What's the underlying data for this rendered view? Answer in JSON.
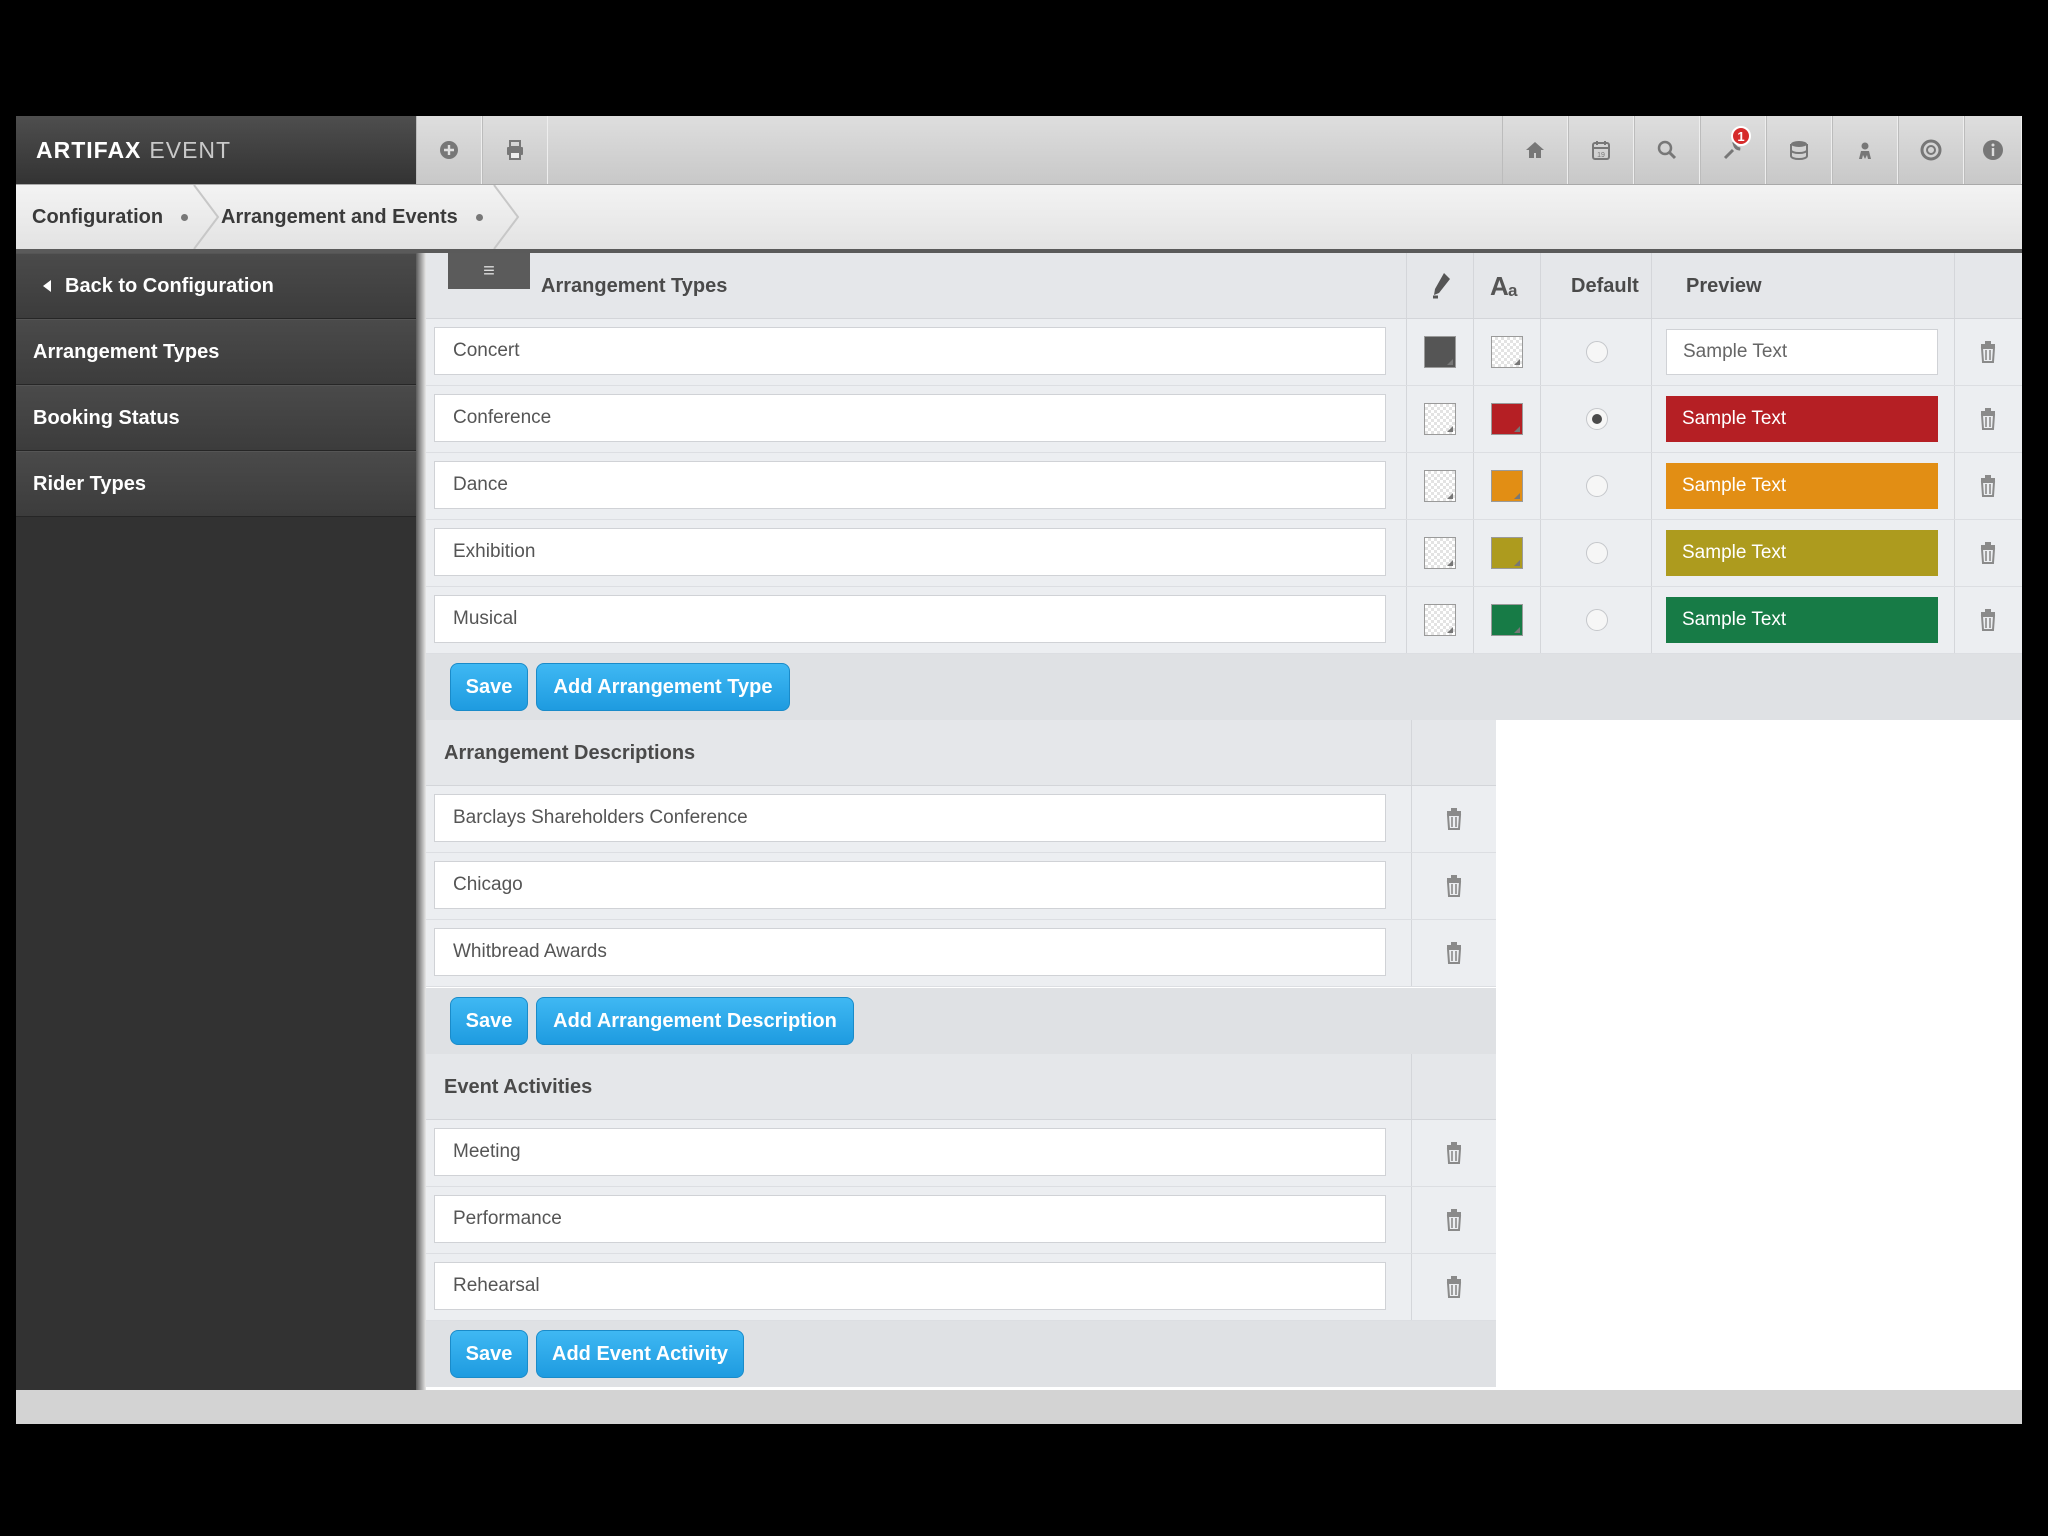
{
  "brand": {
    "name": "ARTIFAX",
    "suffix": "EVENT"
  },
  "topbar": {
    "left_icons": [
      "plus-circle-icon",
      "print-icon"
    ],
    "right_icons": [
      "home-icon",
      "calendar-icon",
      "search-icon",
      "wrench-icon",
      "database-icon",
      "user-icon",
      "help-ring-icon",
      "info-icon"
    ],
    "notification_count": "1"
  },
  "breadcrumb": [
    "Configuration",
    "Arrangement and Events"
  ],
  "sidebar": {
    "back_label": "Back to Configuration",
    "items": [
      "Arrangement Types",
      "Booking Status",
      "Rider Types"
    ]
  },
  "arrangement_types": {
    "title": "Arrangement Types",
    "col_default": "Default",
    "col_preview": "Preview",
    "rows": [
      {
        "name": "Concert",
        "bg": "#555555",
        "fg": "empty",
        "default": false,
        "preview": "Sample Text",
        "preview_bg": "#ffffff",
        "preview_fg": "#666666"
      },
      {
        "name": "Conference",
        "bg": "empty",
        "fg": "#b51f24",
        "default": true,
        "preview": "Sample Text",
        "preview_bg": "#b51f24",
        "preview_fg": "#ffffff"
      },
      {
        "name": "Dance",
        "bg": "empty",
        "fg": "#e28e14",
        "default": false,
        "preview": "Sample Text",
        "preview_bg": "#e28e14",
        "preview_fg": "#ffffff"
      },
      {
        "name": "Exhibition",
        "bg": "empty",
        "fg": "#ad9b1e",
        "default": false,
        "preview": "Sample Text",
        "preview_bg": "#ad9b1e",
        "preview_fg": "#ffffff"
      },
      {
        "name": "Musical",
        "bg": "empty",
        "fg": "#177b46",
        "default": false,
        "preview": "Sample Text",
        "preview_bg": "#177b46",
        "preview_fg": "#ffffff"
      }
    ],
    "save_label": "Save",
    "add_label": "Add Arrangement Type"
  },
  "arrangement_descriptions": {
    "title": "Arrangement Descriptions",
    "rows": [
      "Barclays Shareholders Conference",
      "Chicago",
      "Whitbread Awards"
    ],
    "save_label": "Save",
    "add_label": "Add Arrangement Description"
  },
  "event_activities": {
    "title": "Event Activities",
    "rows": [
      "Meeting",
      "Performance",
      "Rehearsal"
    ],
    "save_label": "Save",
    "add_label": "Add Event Activity"
  }
}
